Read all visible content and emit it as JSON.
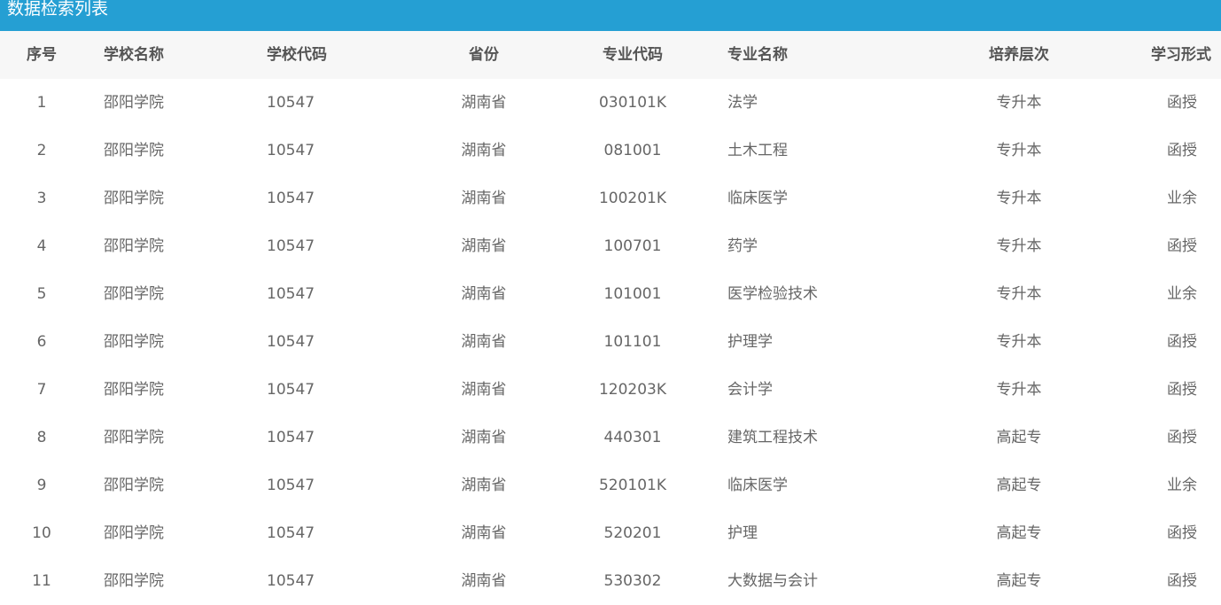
{
  "title": "数据检索列表",
  "headers": {
    "seq": "序号",
    "school_name": "学校名称",
    "school_code": "学校代码",
    "province": "省份",
    "major_code": "专业代码",
    "major_name": "专业名称",
    "level": "培养层次",
    "study_form": "学习形式"
  },
  "rows": [
    {
      "seq": "1",
      "school_name": "邵阳学院",
      "school_code": "10547",
      "province": "湖南省",
      "major_code": "030101K",
      "major_name": "法学",
      "level": "专升本",
      "study_form": "函授"
    },
    {
      "seq": "2",
      "school_name": "邵阳学院",
      "school_code": "10547",
      "province": "湖南省",
      "major_code": "081001",
      "major_name": "土木工程",
      "level": "专升本",
      "study_form": "函授"
    },
    {
      "seq": "3",
      "school_name": "邵阳学院",
      "school_code": "10547",
      "province": "湖南省",
      "major_code": "100201K",
      "major_name": "临床医学",
      "level": "专升本",
      "study_form": "业余"
    },
    {
      "seq": "4",
      "school_name": "邵阳学院",
      "school_code": "10547",
      "province": "湖南省",
      "major_code": "100701",
      "major_name": "药学",
      "level": "专升本",
      "study_form": "函授"
    },
    {
      "seq": "5",
      "school_name": "邵阳学院",
      "school_code": "10547",
      "province": "湖南省",
      "major_code": "101001",
      "major_name": "医学检验技术",
      "level": "专升本",
      "study_form": "业余"
    },
    {
      "seq": "6",
      "school_name": "邵阳学院",
      "school_code": "10547",
      "province": "湖南省",
      "major_code": "101101",
      "major_name": "护理学",
      "level": "专升本",
      "study_form": "函授"
    },
    {
      "seq": "7",
      "school_name": "邵阳学院",
      "school_code": "10547",
      "province": "湖南省",
      "major_code": "120203K",
      "major_name": "会计学",
      "level": "专升本",
      "study_form": "函授"
    },
    {
      "seq": "8",
      "school_name": "邵阳学院",
      "school_code": "10547",
      "province": "湖南省",
      "major_code": "440301",
      "major_name": "建筑工程技术",
      "level": "高起专",
      "study_form": "函授"
    },
    {
      "seq": "9",
      "school_name": "邵阳学院",
      "school_code": "10547",
      "province": "湖南省",
      "major_code": "520101K",
      "major_name": "临床医学",
      "level": "高起专",
      "study_form": "业余"
    },
    {
      "seq": "10",
      "school_name": "邵阳学院",
      "school_code": "10547",
      "province": "湖南省",
      "major_code": "520201",
      "major_name": "护理",
      "level": "高起专",
      "study_form": "函授"
    },
    {
      "seq": "11",
      "school_name": "邵阳学院",
      "school_code": "10547",
      "province": "湖南省",
      "major_code": "530302",
      "major_name": "大数据与会计",
      "level": "高起专",
      "study_form": "函授"
    }
  ],
  "colors": {
    "titlebar_bg": "#259fd3",
    "header_bg": "#f7f7f7",
    "text": "#666666"
  }
}
